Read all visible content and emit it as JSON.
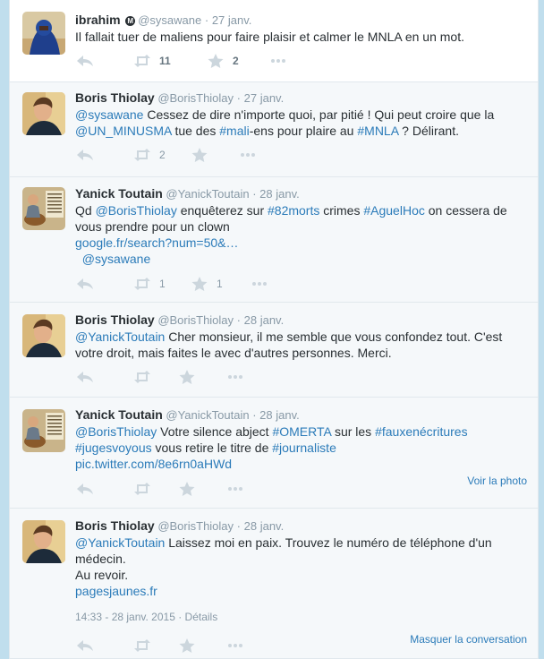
{
  "tweets": [
    {
      "fullname": "ibrahim",
      "username": "@sysawane",
      "time": "27 janv.",
      "lines": [
        [
          {
            "t": "Il fallait tuer de maliens pour faire plaisir et calmer le MNLA en un mot.",
            "l": false
          }
        ]
      ],
      "retweets": "11",
      "favorites": "2"
    },
    {
      "fullname": "Boris Thiolay",
      "username": "@BorisThiolay",
      "time": "27 janv.",
      "lines": [
        [
          {
            "t": "@sysawane",
            "l": true
          },
          {
            "t": " Cessez de dire n'importe quoi, par pitié ! Qui peut croire que la",
            "l": false
          }
        ],
        [
          {
            "t": "@UN_MINUSMA",
            "l": true
          },
          {
            "t": " tue des ",
            "l": false
          },
          {
            "t": "#mali",
            "l": true
          },
          {
            "t": "-ens pour plaire au ",
            "l": false
          },
          {
            "t": "#MNLA",
            "l": true
          },
          {
            "t": " ? Délirant.",
            "l": false
          }
        ]
      ],
      "retweets": "2",
      "favorites": ""
    },
    {
      "fullname": "Yanick Toutain",
      "username": "@YanickToutain",
      "time": "28 janv.",
      "lines": [
        [
          {
            "t": "Qd ",
            "l": false
          },
          {
            "t": "@BorisThiolay",
            "l": true
          },
          {
            "t": " enquêterez sur ",
            "l": false
          },
          {
            "t": "#82morts",
            "l": true
          },
          {
            "t": " crimes ",
            "l": false
          },
          {
            "t": "#AguelHoc",
            "l": true
          },
          {
            "t": " on cessera de",
            "l": false
          }
        ],
        [
          {
            "t": "vous prendre pour un clown",
            "l": false
          }
        ],
        [
          {
            "t": "google.fr/search?num=50&…",
            "l": true
          }
        ],
        [
          {
            "t": "  @sysawane",
            "l": true
          }
        ]
      ],
      "retweets": "1",
      "favorites": "1"
    },
    {
      "fullname": "Boris Thiolay",
      "username": "@BorisThiolay",
      "time": "28 janv.",
      "lines": [
        [
          {
            "t": "@YanickToutain",
            "l": true
          },
          {
            "t": " Cher monsieur, il me semble que vous confondez tout. C'est",
            "l": false
          }
        ],
        [
          {
            "t": "votre droit, mais faites le avec d'autres personnes. Merci.",
            "l": false
          }
        ]
      ],
      "retweets": "",
      "favorites": ""
    },
    {
      "fullname": "Yanick Toutain",
      "username": "@YanickToutain",
      "time": "28 janv.",
      "lines": [
        [
          {
            "t": "@BorisThiolay",
            "l": true
          },
          {
            "t": " Votre silence abject ",
            "l": false
          },
          {
            "t": "#OMERTA",
            "l": true
          },
          {
            "t": " sur les ",
            "l": false
          },
          {
            "t": "#fauxenécritures",
            "l": true
          }
        ],
        [
          {
            "t": "#jugesvoyous",
            "l": true
          },
          {
            "t": " vous retire le titre de ",
            "l": false
          },
          {
            "t": "#journaliste",
            "l": true
          }
        ],
        [
          {
            "t": "pic.twitter.com/8e6rn0aHWd",
            "l": true
          }
        ]
      ],
      "retweets": "",
      "favorites": "",
      "right_link": "Voir la photo"
    },
    {
      "fullname": "Boris Thiolay",
      "username": "@BorisThiolay",
      "time": "28 janv.",
      "lines": [
        [
          {
            "t": "@YanickToutain",
            "l": true
          },
          {
            "t": " Laissez moi en paix. Trouvez le numéro de téléphone d'un",
            "l": false
          }
        ],
        [
          {
            "t": "médecin.",
            "l": false
          }
        ],
        [
          {
            "t": "Au revoir.",
            "l": false
          }
        ],
        [
          {
            "t": "pagesjaunes.fr",
            "l": true
          }
        ]
      ],
      "retweets": "",
      "favorites": "",
      "timestamp": "14:33 - 28 janv. 2015",
      "details": "Détails",
      "right_link": "Masquer la conversation"
    }
  ],
  "sep": "·",
  "verified_badge": "M",
  "colors": {
    "link": "#2b7bb9",
    "muted": "#8899a6",
    "icon": "#ccd6dd",
    "background": "#c0deed"
  },
  "icons": [
    "reply-icon",
    "retweet-icon",
    "favorite-icon",
    "more-icon"
  ]
}
